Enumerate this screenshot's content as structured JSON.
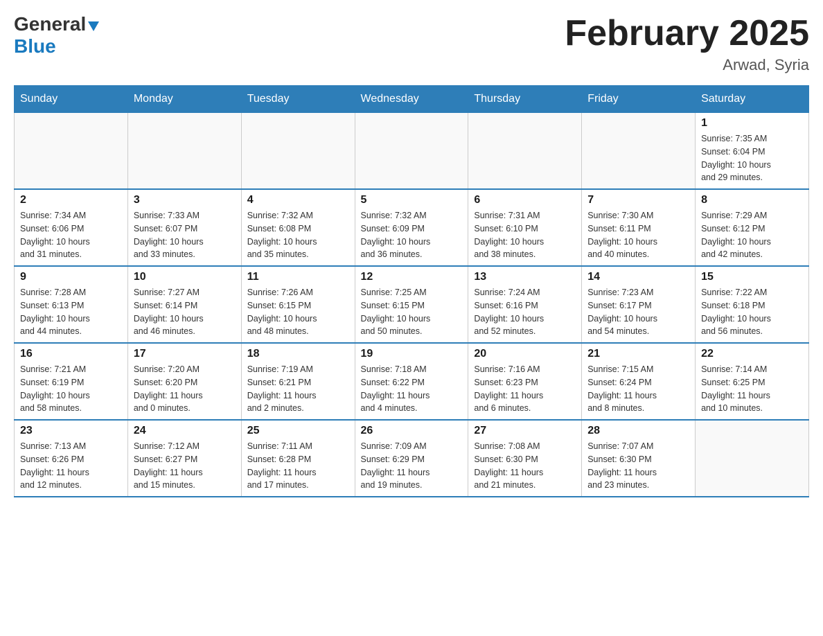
{
  "header": {
    "logo_general": "General",
    "logo_blue": "Blue",
    "main_title": "February 2025",
    "subtitle": "Arwad, Syria"
  },
  "days_of_week": [
    "Sunday",
    "Monday",
    "Tuesday",
    "Wednesday",
    "Thursday",
    "Friday",
    "Saturday"
  ],
  "weeks": [
    {
      "days": [
        {
          "num": "",
          "info": ""
        },
        {
          "num": "",
          "info": ""
        },
        {
          "num": "",
          "info": ""
        },
        {
          "num": "",
          "info": ""
        },
        {
          "num": "",
          "info": ""
        },
        {
          "num": "",
          "info": ""
        },
        {
          "num": "1",
          "info": "Sunrise: 7:35 AM\nSunset: 6:04 PM\nDaylight: 10 hours\nand 29 minutes."
        }
      ]
    },
    {
      "days": [
        {
          "num": "2",
          "info": "Sunrise: 7:34 AM\nSunset: 6:06 PM\nDaylight: 10 hours\nand 31 minutes."
        },
        {
          "num": "3",
          "info": "Sunrise: 7:33 AM\nSunset: 6:07 PM\nDaylight: 10 hours\nand 33 minutes."
        },
        {
          "num": "4",
          "info": "Sunrise: 7:32 AM\nSunset: 6:08 PM\nDaylight: 10 hours\nand 35 minutes."
        },
        {
          "num": "5",
          "info": "Sunrise: 7:32 AM\nSunset: 6:09 PM\nDaylight: 10 hours\nand 36 minutes."
        },
        {
          "num": "6",
          "info": "Sunrise: 7:31 AM\nSunset: 6:10 PM\nDaylight: 10 hours\nand 38 minutes."
        },
        {
          "num": "7",
          "info": "Sunrise: 7:30 AM\nSunset: 6:11 PM\nDaylight: 10 hours\nand 40 minutes."
        },
        {
          "num": "8",
          "info": "Sunrise: 7:29 AM\nSunset: 6:12 PM\nDaylight: 10 hours\nand 42 minutes."
        }
      ]
    },
    {
      "days": [
        {
          "num": "9",
          "info": "Sunrise: 7:28 AM\nSunset: 6:13 PM\nDaylight: 10 hours\nand 44 minutes."
        },
        {
          "num": "10",
          "info": "Sunrise: 7:27 AM\nSunset: 6:14 PM\nDaylight: 10 hours\nand 46 minutes."
        },
        {
          "num": "11",
          "info": "Sunrise: 7:26 AM\nSunset: 6:15 PM\nDaylight: 10 hours\nand 48 minutes."
        },
        {
          "num": "12",
          "info": "Sunrise: 7:25 AM\nSunset: 6:15 PM\nDaylight: 10 hours\nand 50 minutes."
        },
        {
          "num": "13",
          "info": "Sunrise: 7:24 AM\nSunset: 6:16 PM\nDaylight: 10 hours\nand 52 minutes."
        },
        {
          "num": "14",
          "info": "Sunrise: 7:23 AM\nSunset: 6:17 PM\nDaylight: 10 hours\nand 54 minutes."
        },
        {
          "num": "15",
          "info": "Sunrise: 7:22 AM\nSunset: 6:18 PM\nDaylight: 10 hours\nand 56 minutes."
        }
      ]
    },
    {
      "days": [
        {
          "num": "16",
          "info": "Sunrise: 7:21 AM\nSunset: 6:19 PM\nDaylight: 10 hours\nand 58 minutes."
        },
        {
          "num": "17",
          "info": "Sunrise: 7:20 AM\nSunset: 6:20 PM\nDaylight: 11 hours\nand 0 minutes."
        },
        {
          "num": "18",
          "info": "Sunrise: 7:19 AM\nSunset: 6:21 PM\nDaylight: 11 hours\nand 2 minutes."
        },
        {
          "num": "19",
          "info": "Sunrise: 7:18 AM\nSunset: 6:22 PM\nDaylight: 11 hours\nand 4 minutes."
        },
        {
          "num": "20",
          "info": "Sunrise: 7:16 AM\nSunset: 6:23 PM\nDaylight: 11 hours\nand 6 minutes."
        },
        {
          "num": "21",
          "info": "Sunrise: 7:15 AM\nSunset: 6:24 PM\nDaylight: 11 hours\nand 8 minutes."
        },
        {
          "num": "22",
          "info": "Sunrise: 7:14 AM\nSunset: 6:25 PM\nDaylight: 11 hours\nand 10 minutes."
        }
      ]
    },
    {
      "days": [
        {
          "num": "23",
          "info": "Sunrise: 7:13 AM\nSunset: 6:26 PM\nDaylight: 11 hours\nand 12 minutes."
        },
        {
          "num": "24",
          "info": "Sunrise: 7:12 AM\nSunset: 6:27 PM\nDaylight: 11 hours\nand 15 minutes."
        },
        {
          "num": "25",
          "info": "Sunrise: 7:11 AM\nSunset: 6:28 PM\nDaylight: 11 hours\nand 17 minutes."
        },
        {
          "num": "26",
          "info": "Sunrise: 7:09 AM\nSunset: 6:29 PM\nDaylight: 11 hours\nand 19 minutes."
        },
        {
          "num": "27",
          "info": "Sunrise: 7:08 AM\nSunset: 6:30 PM\nDaylight: 11 hours\nand 21 minutes."
        },
        {
          "num": "28",
          "info": "Sunrise: 7:07 AM\nSunset: 6:30 PM\nDaylight: 11 hours\nand 23 minutes."
        },
        {
          "num": "",
          "info": ""
        }
      ]
    }
  ]
}
